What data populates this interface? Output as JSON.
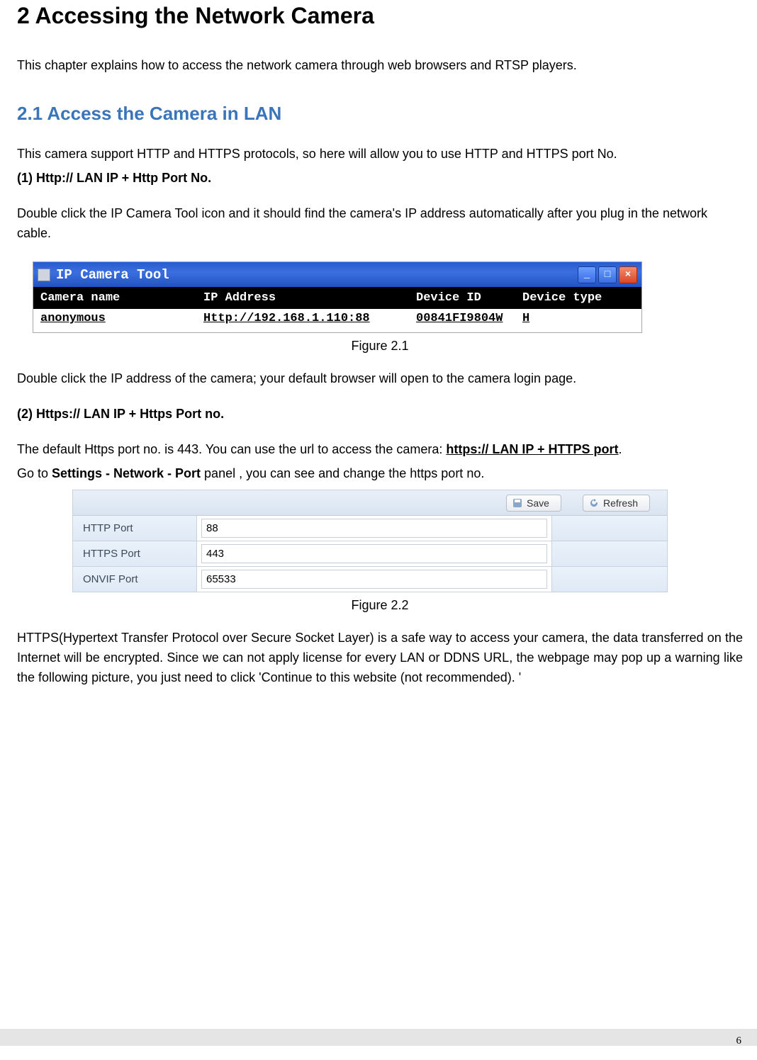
{
  "headings": {
    "h1": "2 Accessing the Network Camera",
    "h2_1": "2.1 Access the Camera in LAN"
  },
  "paras": {
    "intro": "This chapter explains how to access the network camera through web browsers and RTSP players.",
    "p2": "This camera support HTTP and HTTPS protocols, so here will allow you to use HTTP and HTTPS port No.",
    "p3_label": "(1)  Http:// LAN IP + Http Port No.",
    "p4": "Double click the IP Camera Tool icon and it should find the camera's IP address automatically after you plug in the network cable.",
    "p5": "Double click the IP address of the camera; your default browser will open to the camera login page.",
    "p6_label": "(2)  Https:// LAN IP + Https Port no.",
    "p7a": "The default Https port no. is 443. You can use the url to access the camera: ",
    "p7b": "https:// LAN IP + HTTPS port",
    "p7c": ".",
    "p8a": "Go to ",
    "p8b": "Settings - Network - Port",
    "p8c": " panel , you can see and change the https port no.",
    "p9": "HTTPS(Hypertext Transfer Protocol over Secure Socket Layer) is a safe way to access your camera, the data transferred on the Internet will be encrypted. Since we can not apply license for every LAN or DDNS URL, the webpage may pop up a warning like the following picture, you just need to click 'Continue to this website (not recommended). '"
  },
  "captions": {
    "fig21": "Figure 2.1",
    "fig22": "Figure 2.2"
  },
  "ip_tool": {
    "title": "IP Camera Tool",
    "headers": {
      "c1": "Camera name",
      "c2": "IP Address",
      "c3": "Device ID",
      "c4": "Device type"
    },
    "row": {
      "c1": "anonymous",
      "c2": "Http://192.168.1.110:88",
      "c3": "00841FI9804W",
      "c4": "H"
    },
    "win": {
      "min": "_",
      "max": "□",
      "close": "×"
    }
  },
  "port_panel": {
    "buttons": {
      "save": "Save",
      "refresh": "Refresh"
    },
    "rows": [
      {
        "label": "HTTP Port",
        "value": "88"
      },
      {
        "label": "HTTPS Port",
        "value": "443"
      },
      {
        "label": "ONVIF Port",
        "value": "65533"
      }
    ]
  },
  "page_number": "6"
}
